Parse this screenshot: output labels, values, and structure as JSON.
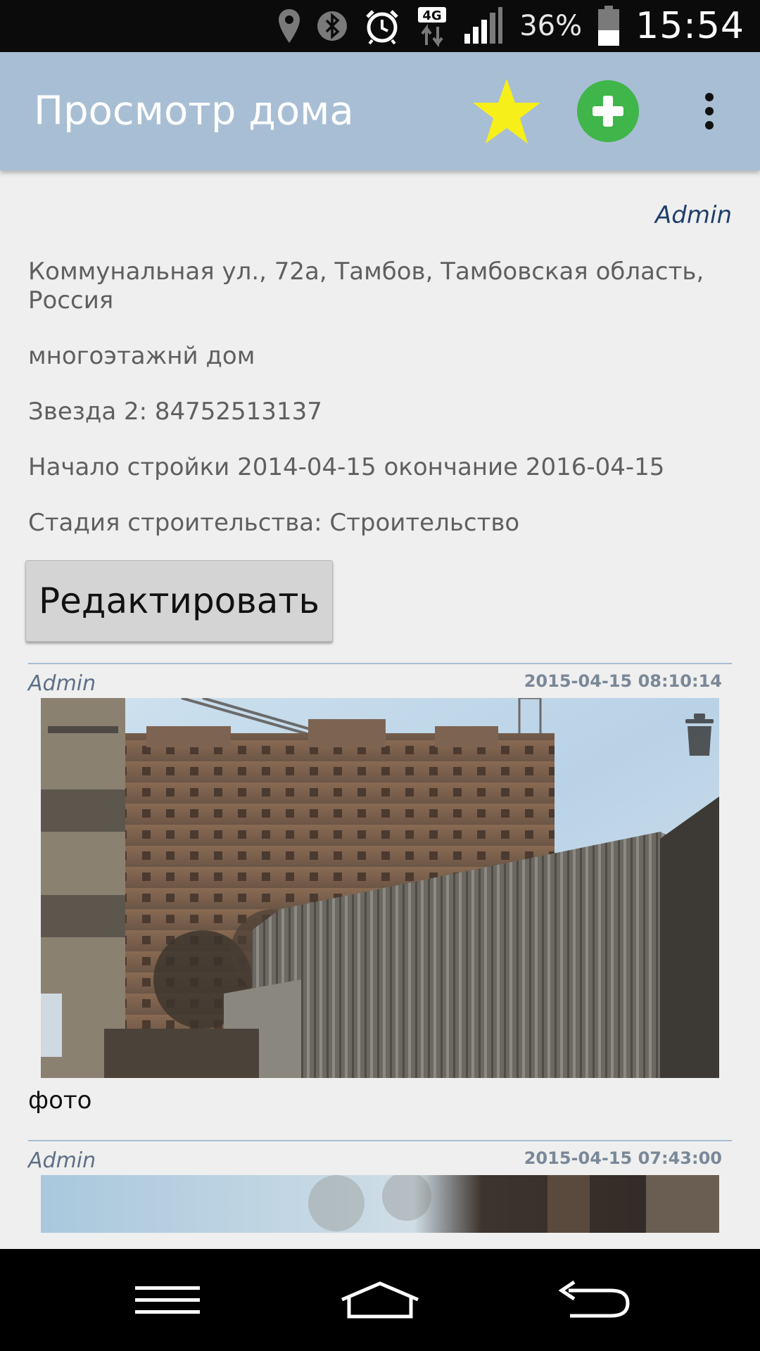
{
  "status_bar": {
    "network_label": "4G",
    "battery_percent": "36%",
    "time": "15:54",
    "icons": [
      "location-icon",
      "bluetooth-icon",
      "alarm-icon",
      "network-4g-icon",
      "signal-icon",
      "battery-icon"
    ]
  },
  "action_bar": {
    "title": "Просмотр дома",
    "favorite_icon_color": "#f7ef1a",
    "add_button_color": "#3fb54a",
    "background": "#a8bed4"
  },
  "house": {
    "owner": "Admin",
    "address": "Коммунальная ул., 72а, Тамбов, Тамбовская область, Россия",
    "type": "многоэтажнй дом",
    "star_phone": "Звезда 2: 84752513137",
    "construction_dates": "Начало стройки 2014-04-15 окончание 2016-04-15",
    "construction_stage": "Стадия строительства: Строительство",
    "edit_label": "Редактировать"
  },
  "posts": [
    {
      "author": "Admin",
      "timestamp": "2015-04-15 08:10:14",
      "caption": "фото",
      "image": "construction-site-photo"
    },
    {
      "author": "Admin",
      "timestamp": "2015-04-15 07:43:00",
      "caption": "",
      "image": "construction-site-photo-2"
    }
  ],
  "nav_bar": {
    "icons": [
      "menu-icon",
      "home-icon",
      "back-icon"
    ]
  }
}
